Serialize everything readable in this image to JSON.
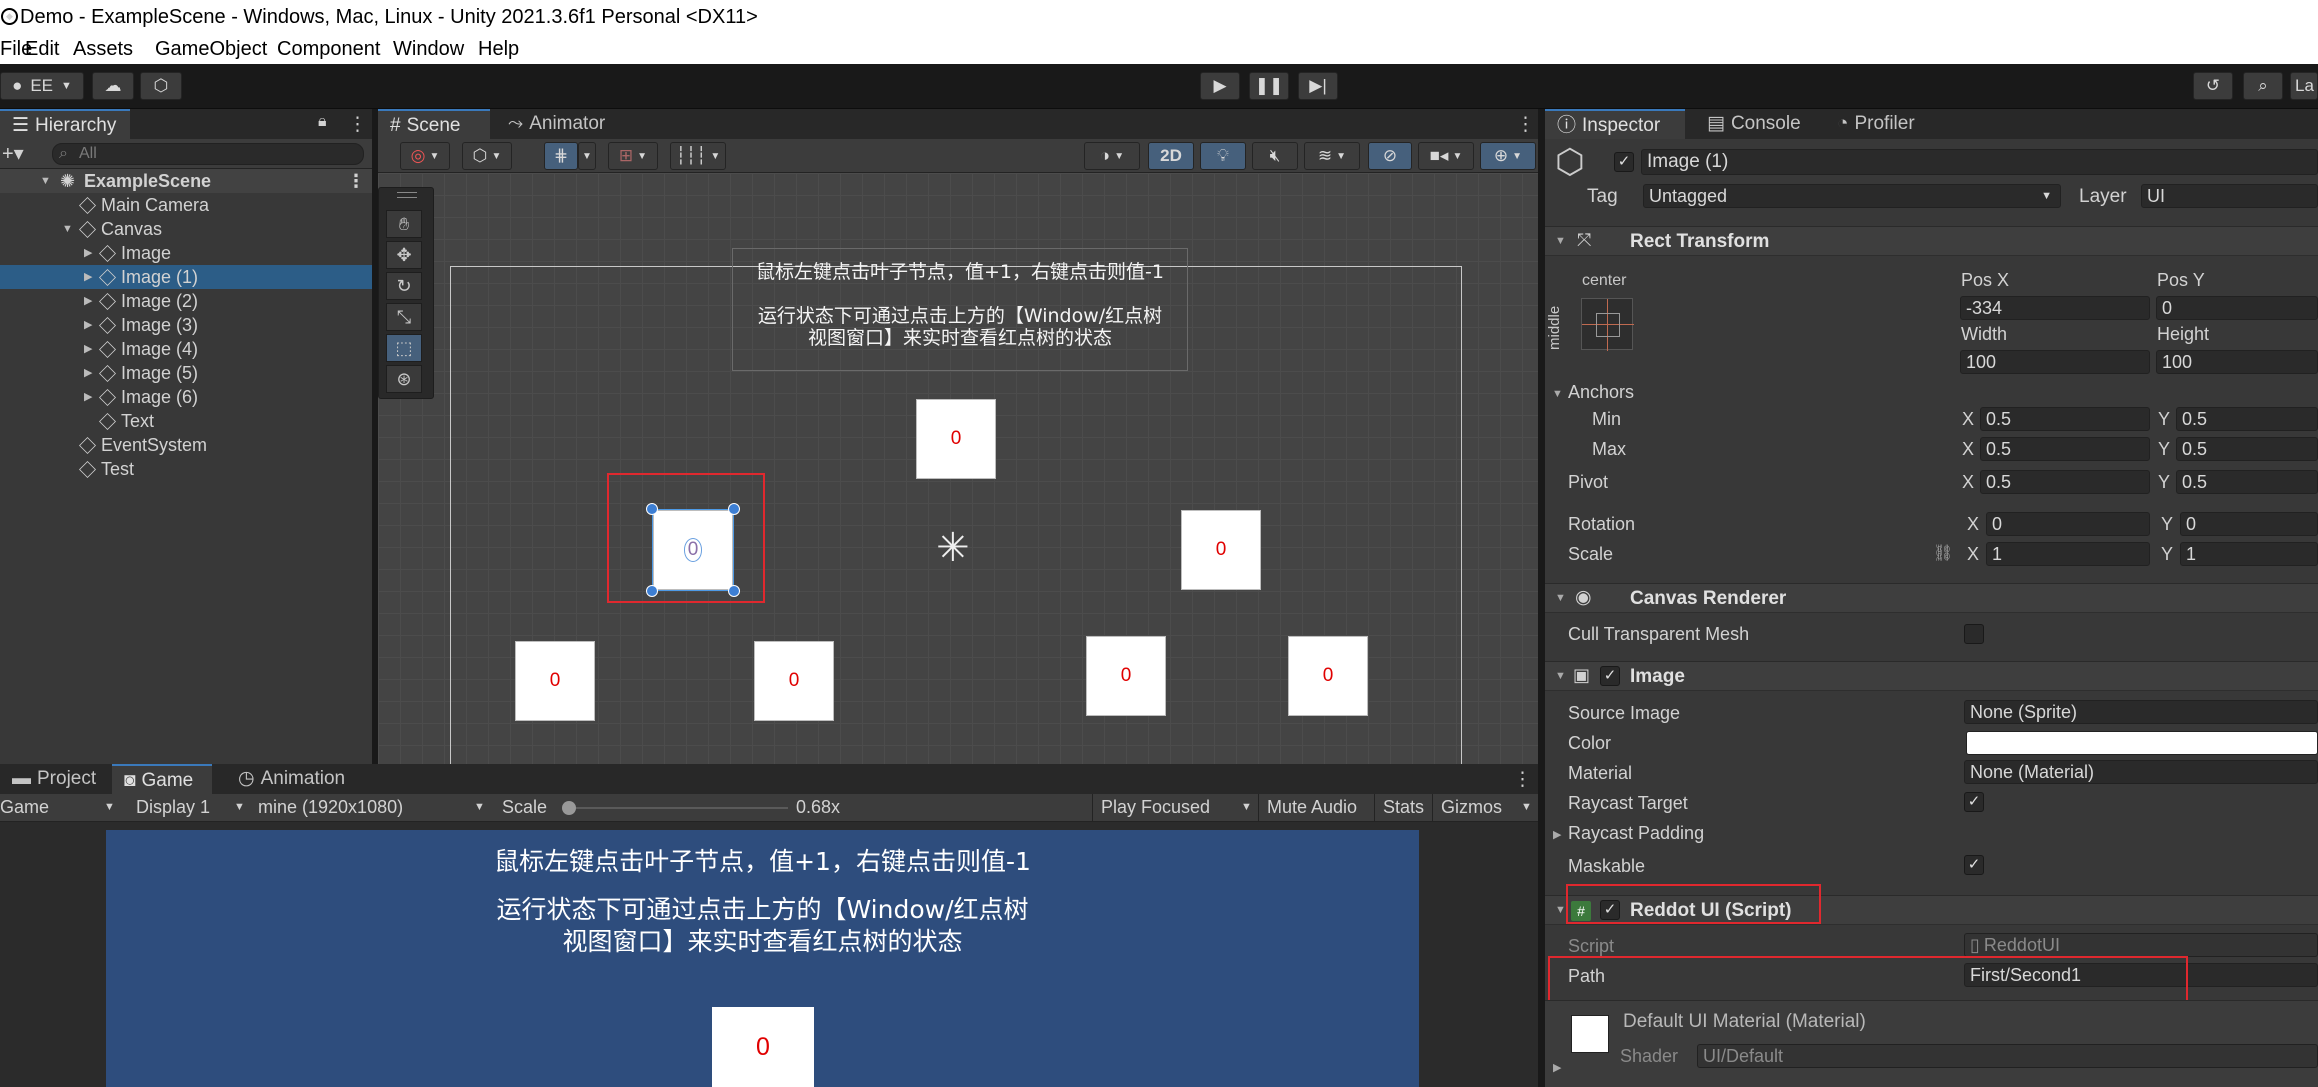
{
  "window": {
    "title": "Demo - ExampleScene - Windows, Mac, Linux - Unity 2021.3.6f1 Personal <DX11>"
  },
  "menu": [
    "File",
    "Edit",
    "Assets",
    "GameObject",
    "Component",
    "Window",
    "Help"
  ],
  "toolbar": {
    "account": "EE",
    "layers_right": "La"
  },
  "hierarchy": {
    "tab": "Hierarchy",
    "search_placeholder": "All",
    "scene": "ExampleScene",
    "items": [
      {
        "label": "Main Camera"
      },
      {
        "label": "Canvas"
      },
      {
        "label": "Image"
      },
      {
        "label": "Image (1)"
      },
      {
        "label": "Image (2)"
      },
      {
        "label": "Image (3)"
      },
      {
        "label": "Image (4)"
      },
      {
        "label": "Image (5)"
      },
      {
        "label": "Image (6)"
      },
      {
        "label": "Text"
      },
      {
        "label": "EventSystem"
      },
      {
        "label": "Test"
      }
    ]
  },
  "scene": {
    "tabs": [
      "Scene",
      "Animator"
    ],
    "mode_2d": "2D",
    "text_line1": "鼠标左键点击叶子节点，值+1，右键点击则值-1",
    "text_line2": "运行状态下可通过点击上方的【Window/红点树",
    "text_line3": "视图窗口】来实时查看红点树的状态",
    "node_values": [
      "0",
      "0",
      "0",
      "0",
      "0",
      "0",
      "0"
    ]
  },
  "bottom": {
    "tabs": [
      "Project",
      "Game",
      "Animation"
    ],
    "game_dropdown": "Game",
    "display": "Display 1",
    "resolution": "mine (1920x1080)",
    "scale_label": "Scale",
    "scale_value": "0.68x",
    "play_focused": "Play Focused",
    "mute_audio": "Mute Audio",
    "stats": "Stats",
    "gizmos": "Gizmos",
    "game_text1": "鼠标左键点击叶子节点，值+1，右键点击则值-1",
    "game_text2": "运行状态下可通过点击上方的【Window/红点树",
    "game_text3": "视图窗口】来实时查看红点树的状态",
    "game_value": "0"
  },
  "inspector": {
    "tabs": [
      "Inspector",
      "Console",
      "Profiler"
    ],
    "object_name": "Image (1)",
    "tag_label": "Tag",
    "tag_value": "Untagged",
    "layer_label": "Layer",
    "layer_value": "UI",
    "rect_transform": {
      "title": "Rect Transform",
      "anchor_h": "center",
      "anchor_v": "middle",
      "pos_x_label": "Pos X",
      "pos_x": "-334",
      "pos_y_label": "Pos Y",
      "pos_y": "0",
      "width_label": "Width",
      "width": "100",
      "height_label": "Height",
      "height": "100",
      "anchors": "Anchors",
      "min": "Min",
      "min_x": "0.5",
      "min_y": "0.5",
      "max": "Max",
      "max_x": "0.5",
      "max_y": "0.5",
      "pivot": "Pivot",
      "pivot_x": "0.5",
      "pivot_y": "0.5",
      "rotation": "Rotation",
      "rot_x": "0",
      "rot_y": "0",
      "scale": "Scale",
      "scale_x": "1",
      "scale_y": "1",
      "x": "X",
      "y": "Y"
    },
    "canvas_renderer": {
      "title": "Canvas Renderer",
      "cull": "Cull Transparent Mesh"
    },
    "image": {
      "title": "Image",
      "source_image": "Source Image",
      "source_value": "None (Sprite)",
      "color": "Color",
      "material": "Material",
      "material_value": "None (Material)",
      "raycast_target": "Raycast Target",
      "raycast_padding": "Raycast Padding",
      "maskable": "Maskable"
    },
    "reddot": {
      "title": "Reddot UI (Script)",
      "script_label": "Script",
      "script_value": "ReddotUI",
      "path_label": "Path",
      "path_value": "First/Second1"
    },
    "material_block": {
      "name": "Default UI Material (Material)",
      "shader_label": "Shader",
      "shader_value": "UI/Default"
    }
  },
  "colors": {
    "selection": "#2c5d87",
    "highlight_box": "#e0282e",
    "game_bg": "#2e4d7d",
    "reddot_text": "#e00000"
  }
}
